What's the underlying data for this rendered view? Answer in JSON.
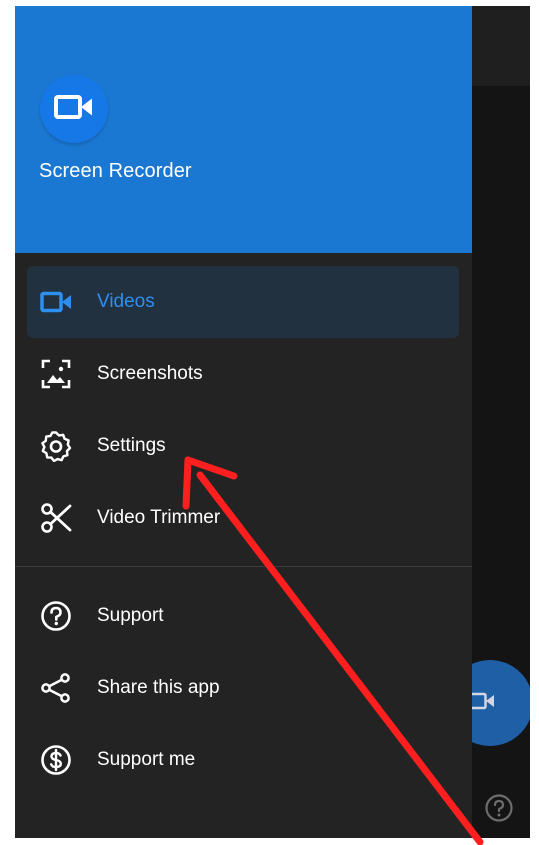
{
  "app": {
    "name": "Screen Recorder",
    "logo_icon": "video-camera-icon"
  },
  "nav": {
    "primary": [
      {
        "label": "Videos",
        "icon": "video-camera-icon",
        "active": true
      },
      {
        "label": "Screenshots",
        "icon": "screenshot-icon",
        "active": false
      },
      {
        "label": "Settings",
        "icon": "gear-icon",
        "active": false
      },
      {
        "label": "Video Trimmer",
        "icon": "scissors-icon",
        "active": false
      }
    ],
    "secondary": [
      {
        "label": "Support",
        "icon": "help-icon"
      },
      {
        "label": "Share this app",
        "icon": "share-icon"
      },
      {
        "label": "Support me",
        "icon": "dollar-icon"
      }
    ]
  },
  "background": {
    "fab_icon": "video-camera-icon",
    "help_icon": "help-icon"
  },
  "colors": {
    "header_blue": "#1b78d2",
    "accent_blue": "#2d8ff0",
    "drawer_bg": "#232323",
    "arrow_red": "#ff1f1f"
  }
}
